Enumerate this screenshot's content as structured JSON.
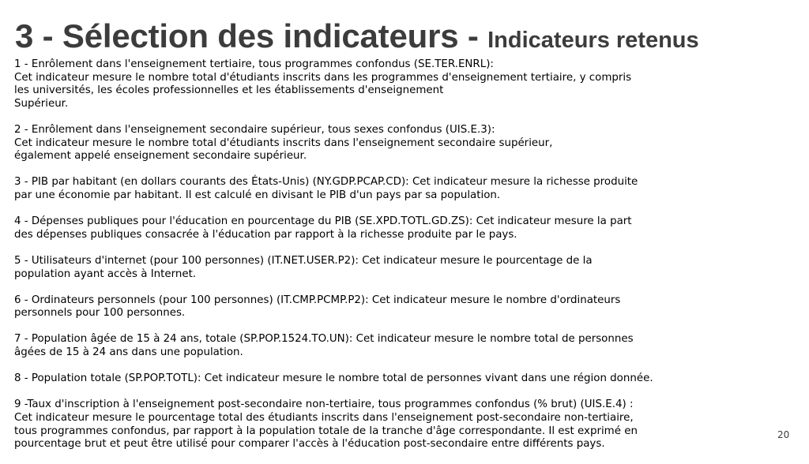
{
  "title": {
    "main": "3 - Sélection des indicateurs - ",
    "sub": "Indicateurs retenus"
  },
  "paragraphs": [
    {
      "lines": [
        "1 - Enrôlement dans l'enseignement tertiaire, tous programmes confondus (SE.TER.ENRL):",
        "Cet indicateur mesure le nombre total d'étudiants inscrits dans les programmes d'enseignement tertiaire, y compris",
        "les universités, les écoles professionnelles et les établissements d'enseignement",
        "Supérieur."
      ]
    },
    {
      "lines": [
        "2 - Enrôlement dans l'enseignement secondaire supérieur, tous sexes confondus (UIS.E.3):",
        "Cet indicateur mesure le nombre total d'étudiants inscrits dans l'enseignement secondaire supérieur,",
        "également appelé enseignement secondaire supérieur."
      ]
    },
    {
      "lines": [
        "3 - PIB par habitant (en dollars courants des États-Unis) (NY.GDP.PCAP.CD): Cet indicateur mesure la richesse produite",
        "par une économie par habitant. Il est calculé en divisant le PIB d'un pays par sa population."
      ]
    },
    {
      "lines": [
        "4 - Dépenses publiques pour l'éducation en pourcentage du PIB (SE.XPD.TOTL.GD.ZS): Cet indicateur mesure la part",
        "des dépenses publiques consacrée à l'éducation par rapport à la richesse produite par le pays."
      ]
    },
    {
      "lines": [
        "5 - Utilisateurs d'internet (pour 100 personnes) (IT.NET.USER.P2): Cet indicateur mesure le pourcentage de la",
        "population ayant accès à Internet."
      ]
    },
    {
      "lines": [
        "6 - Ordinateurs personnels (pour 100 personnes) (IT.CMP.PCMP.P2): Cet indicateur mesure le nombre d'ordinateurs",
        "personnels pour 100 personnes."
      ]
    },
    {
      "lines": [
        "7 - Population âgée de 15 à 24 ans, totale (SP.POP.1524.TO.UN): Cet indicateur mesure le nombre total de personnes",
        "âgées de 15 à 24 ans dans une population."
      ]
    },
    {
      "lines": [
        "8 - Population totale (SP.POP.TOTL): Cet indicateur mesure le nombre total de personnes vivant dans une région donnée."
      ]
    },
    {
      "lines": [
        "9 -Taux d'inscription à l'enseignement post-secondaire non-tertiaire, tous programmes confondus (% brut) (UIS.E.4) :",
        "Cet indicateur mesure le pourcentage total des étudiants inscrits dans l'enseignement post-secondaire non-tertiaire,",
        "tous programmes confondus, par rapport à la population totale de la tranche d'âge correspondante. Il est exprimé en",
        "pourcentage brut et peut être utilisé pour comparer l'accès à l'éducation post-secondaire entre différents pays."
      ]
    }
  ],
  "page_number": "20"
}
